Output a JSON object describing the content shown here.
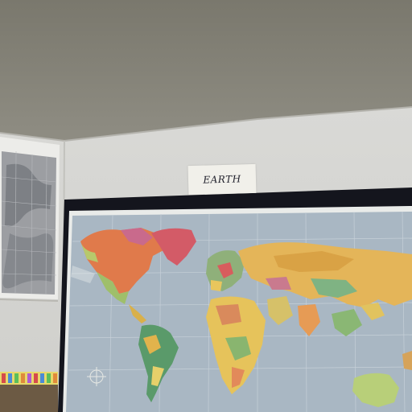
{
  "scene": {
    "sign_text": "EARTH"
  },
  "colors": {
    "ceiling": "#807d72",
    "wall": "#d6d6d2",
    "frame": "#14151d",
    "ocean": "#a8b6c2",
    "sign": "#f1f0ea"
  }
}
